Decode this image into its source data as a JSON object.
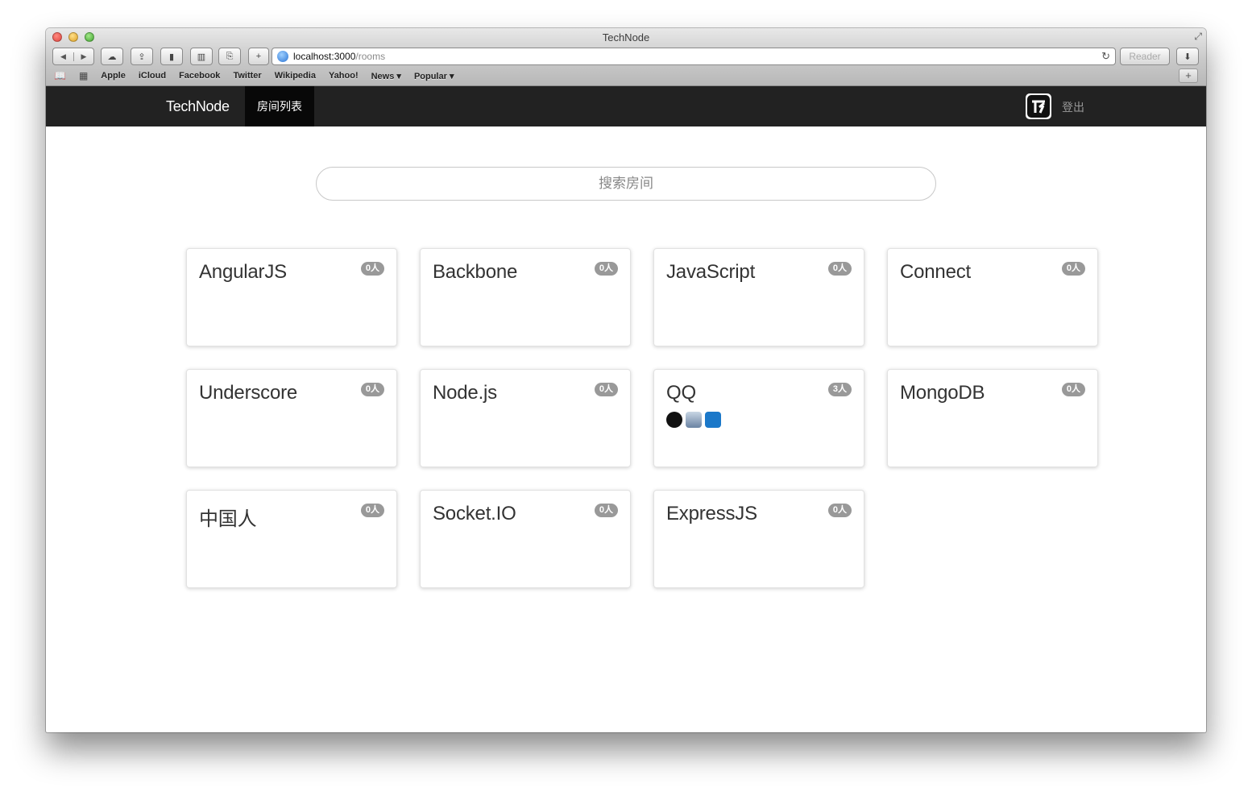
{
  "browser": {
    "window_title": "TechNode",
    "url_host": "localhost:3000",
    "url_path": "/rooms",
    "reader_label": "Reader",
    "bookmarks": [
      "Apple",
      "iCloud",
      "Facebook",
      "Twitter",
      "Wikipedia",
      "Yahoo!",
      "News ▾",
      "Popular ▾"
    ]
  },
  "navbar": {
    "brand": "TechNode",
    "active_tab": "房间列表",
    "logout": "登出"
  },
  "search": {
    "placeholder": "搜索房间"
  },
  "rooms": [
    {
      "name": "AngularJS",
      "count": "0人"
    },
    {
      "name": "Backbone",
      "count": "0人"
    },
    {
      "name": "JavaScript",
      "count": "0人"
    },
    {
      "name": "Connect",
      "count": "0人"
    },
    {
      "name": "Underscore",
      "count": "0人"
    },
    {
      "name": "Node.js",
      "count": "0人"
    },
    {
      "name": "QQ",
      "count": "3人"
    },
    {
      "name": "MongoDB",
      "count": "0人"
    },
    {
      "name": "中国人",
      "count": "0人"
    },
    {
      "name": "Socket.IO",
      "count": "0人"
    },
    {
      "name": "ExpressJS",
      "count": "0人"
    }
  ]
}
